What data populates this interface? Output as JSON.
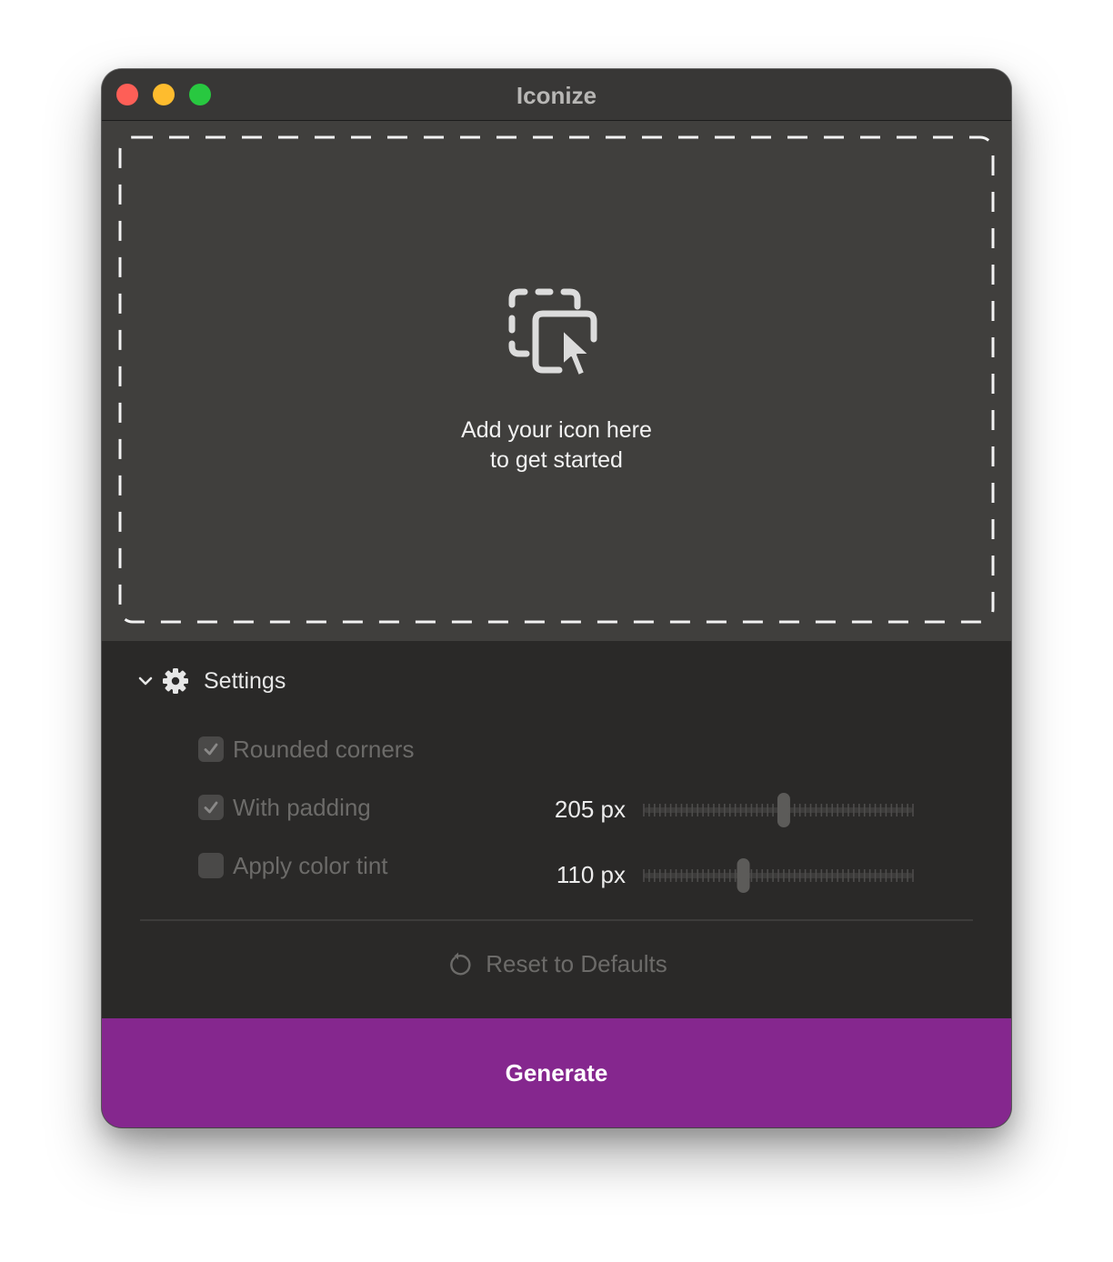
{
  "window": {
    "title": "Iconize",
    "controls": [
      "close",
      "minimize",
      "zoom"
    ]
  },
  "drop_zone": {
    "icon": "drag-drop-icon",
    "line1": "Add your icon here",
    "line2": "to get started"
  },
  "settings": {
    "title": "Settings",
    "chevron_icon": "chevron-down-icon",
    "gear_icon": "gear-icon",
    "options": [
      {
        "label": "Rounded corners",
        "checked": true
      },
      {
        "label": "With padding",
        "checked": true
      },
      {
        "label": "Apply color tint",
        "checked": false
      }
    ],
    "sliders": [
      {
        "value_label": "205 px",
        "value": 205,
        "level": 0.52
      },
      {
        "value_label": "110 px",
        "value": 110,
        "level": 0.37
      }
    ],
    "reset_label": "Reset to Defaults",
    "reset_icon": "reset-icon"
  },
  "generate_label": "Generate",
  "colors": {
    "accent": "#85278e",
    "window_bg": "#2a2928",
    "drop_zone_bg": "#403f3d",
    "titlebar_bg": "#383736",
    "close": "#fe5f57",
    "minimize": "#febc2e",
    "zoom": "#28c840"
  }
}
